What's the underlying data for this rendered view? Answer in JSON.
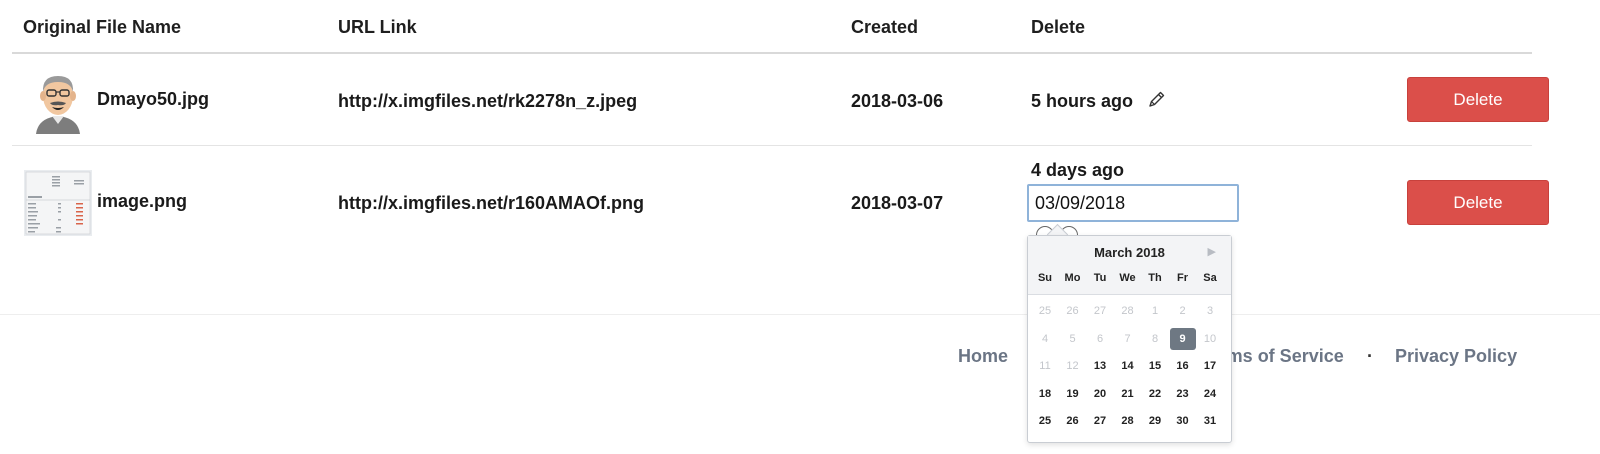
{
  "table": {
    "headers": [
      "Original File Name",
      "URL Link",
      "Created",
      "Delete"
    ],
    "rows": [
      {
        "file_name": "Dmayo50.jpg",
        "thumbnail": "avatar-cartoon-man",
        "url": "http://x.imgfiles.net/rk2278n_z.jpeg",
        "created": "2018-03-06",
        "expires": "5 hours ago",
        "edit_icon": "pencil-icon",
        "delete_label": "Delete"
      },
      {
        "file_name": "image.png",
        "thumbnail": "spreadsheet-table",
        "url": "http://x.imgfiles.net/r160AMAOf.png",
        "created": "2018-03-07",
        "expires": "4 days ago",
        "date_input_value": "03/09/2018",
        "delete_label": "Delete"
      }
    ]
  },
  "datepicker": {
    "month_label": "March 2018",
    "weekdays": [
      "Su",
      "Mo",
      "Tu",
      "We",
      "Th",
      "Fr",
      "Sa"
    ],
    "weeks": [
      [
        "25",
        "26",
        "27",
        "28",
        "1",
        "2",
        "3"
      ],
      [
        "4",
        "5",
        "6",
        "7",
        "8",
        "9",
        "10"
      ],
      [
        "11",
        "12",
        "13",
        "14",
        "15",
        "16",
        "17"
      ],
      [
        "18",
        "19",
        "20",
        "21",
        "22",
        "23",
        "24"
      ],
      [
        "25",
        "26",
        "27",
        "28",
        "29",
        "30",
        "31"
      ]
    ],
    "selected": "9",
    "disabled_through_week_index": 1,
    "first_enabled_day": "13"
  },
  "footer": {
    "links": [
      "Home",
      "Terms of Service",
      "Privacy Policy"
    ],
    "separator": "·"
  },
  "colors": {
    "delete_button": "#db4f4a",
    "footer_link": "#6b7585",
    "selected_day": "#6e7883",
    "input_border": "#8fb3d9"
  }
}
